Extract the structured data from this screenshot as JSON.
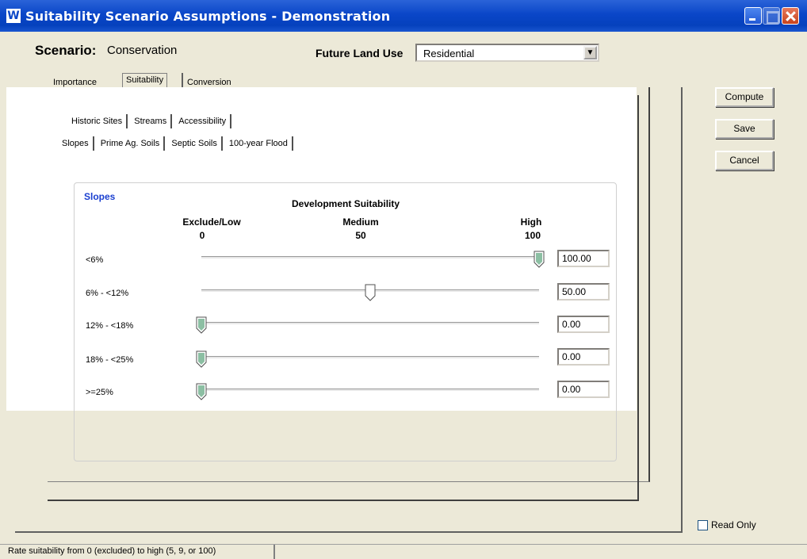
{
  "window": {
    "title": "Suitability Scenario Assumptions - Demonstration",
    "app_icon": "W"
  },
  "scenario": {
    "label": "Scenario:",
    "value": "Conservation"
  },
  "future_land_use": {
    "label": "Future Land Use",
    "selected": "Residential"
  },
  "tabs": [
    {
      "label": "Importance",
      "active": false
    },
    {
      "label": "Suitability",
      "active": true
    },
    {
      "label": "Conversion",
      "active": false
    }
  ],
  "subtabs_row1": [
    "Historic Sites",
    "Streams",
    "Accessibility"
  ],
  "subtabs_row2": [
    "Slopes",
    "Prime Ag. Soils",
    "Septic Soils",
    "100-year Flood"
  ],
  "slopes_panel": {
    "title": "Slopes",
    "dev_suitability": "Development Suitability",
    "headers": {
      "low": "Exclude/Low",
      "low_num": "0",
      "medium": "Medium",
      "medium_num": "50",
      "high": "High",
      "high_num": "100"
    },
    "rows": [
      {
        "label": "<6%",
        "value": "100.00",
        "level": 100
      },
      {
        "label": "6% - <12%",
        "value": "50.00",
        "level": 50
      },
      {
        "label": "12% - <18%",
        "value": "0.00",
        "level": 0
      },
      {
        "label": "18% - <25%",
        "value": "0.00",
        "level": 0
      },
      {
        "label": ">=25%",
        "value": "0.00",
        "level": 0
      }
    ]
  },
  "buttons": {
    "compute": "Compute",
    "save": "Save",
    "cancel": "Cancel"
  },
  "read_only": {
    "label": "Read Only",
    "checked": false
  },
  "status": {
    "text": "Rate suitability from 0 (excluded) to high (5, 9, or 100)"
  },
  "colors": {
    "titlebar": "#0a46c8",
    "slopes_title": "#1a3fd0",
    "thumb_fill": "#2e8b57"
  }
}
